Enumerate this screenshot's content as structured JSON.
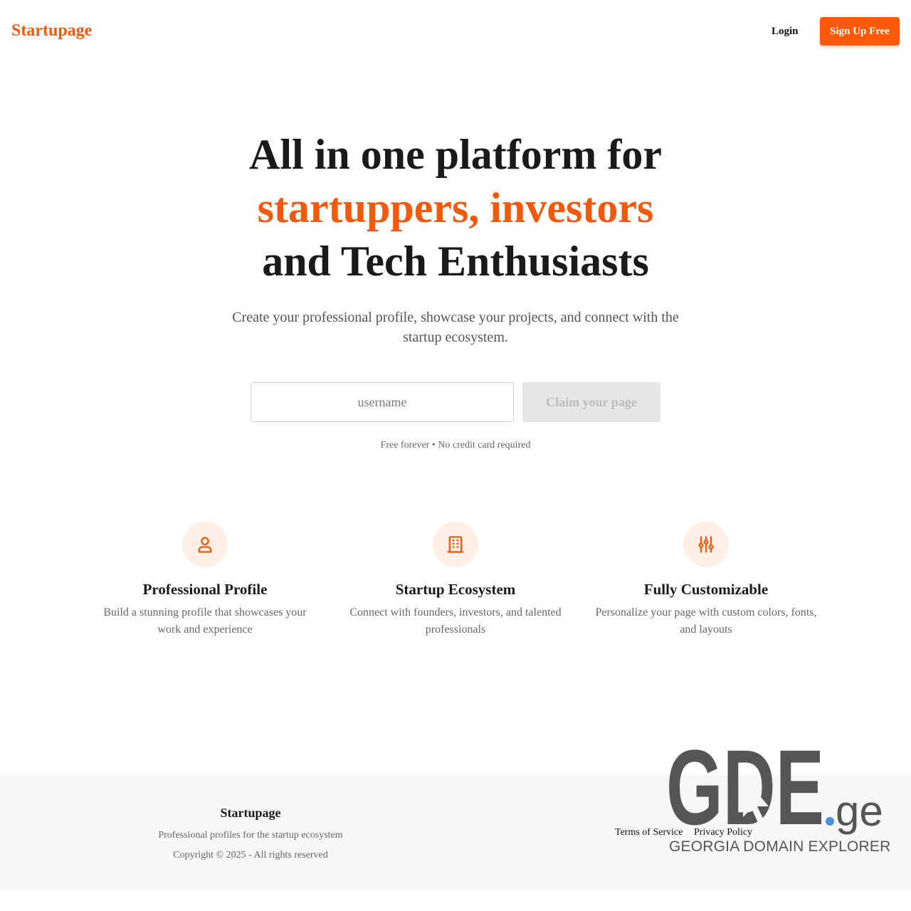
{
  "nav": {
    "brand": "Startupage",
    "login": "Login",
    "signup": "Sign Up Free"
  },
  "hero": {
    "line1": "All in one platform for",
    "accent": "startuppers, investors",
    "line3": "and Tech Enthusiasts",
    "subtitle": "Create your professional profile, showcase your projects, and connect with the startup ecosystem."
  },
  "claim": {
    "placeholder": "username",
    "button": "Claim your page",
    "note": "Free forever • No credit card required"
  },
  "features": [
    {
      "icon": "user-icon",
      "title": "Professional Profile",
      "desc": "Build a stunning profile that showcases your work and experience"
    },
    {
      "icon": "building-icon",
      "title": "Startup Ecosystem",
      "desc": "Connect with founders, investors, and talented professionals"
    },
    {
      "icon": "sliders-icon",
      "title": "Fully Customizable",
      "desc": "Personalize your page with custom colors, fonts, and layouts"
    }
  ],
  "footer": {
    "brand": "Startupage",
    "tagline": "Professional profiles for the startup ecosystem",
    "copyright": "Copyright © 2025 - All rights reserved",
    "links": [
      "Terms of Service",
      "Privacy Policy"
    ]
  },
  "watermark": {
    "logo": "GDE.ge",
    "subtitle": "GEORGIA DOMAIN EXPLORER"
  },
  "colors": {
    "accent": "#f15a0c",
    "button": "#ff5a0a",
    "icon_bg": "#fff0e7",
    "footer_bg": "#f6f7f9"
  }
}
